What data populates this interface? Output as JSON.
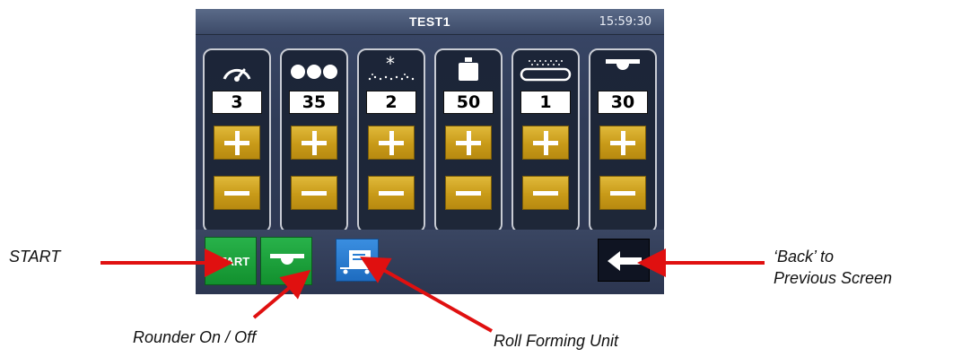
{
  "screen": {
    "title": "TEST1",
    "clock": "15:59:30"
  },
  "panels": [
    {
      "icon": "speed-gauge-icon",
      "value": "3"
    },
    {
      "icon": "dough-balls-icon",
      "value": "35"
    },
    {
      "icon": "flour-sprinkle-icon",
      "value": "2"
    },
    {
      "icon": "weight-icon",
      "value": "50"
    },
    {
      "icon": "conveyor-belt-icon",
      "value": "1"
    },
    {
      "icon": "rounder-icon",
      "value": "30"
    }
  ],
  "toolbar": {
    "start_label": "START",
    "rounder_icon": "rounder-icon",
    "roll_icon": "roll-forming-unit-icon",
    "back_icon": "back-arrow-icon"
  },
  "annotations": {
    "start": "START",
    "rounder": "Rounder On / Off",
    "roll": "Roll Forming Unit",
    "back_line1": "‘Back’ to",
    "back_line2": "Previous Screen"
  },
  "colors": {
    "arrow": "#e01010",
    "button_gold": "#d4aa28",
    "start_green": "#1fa33c",
    "roll_blue": "#2a7ed2"
  }
}
